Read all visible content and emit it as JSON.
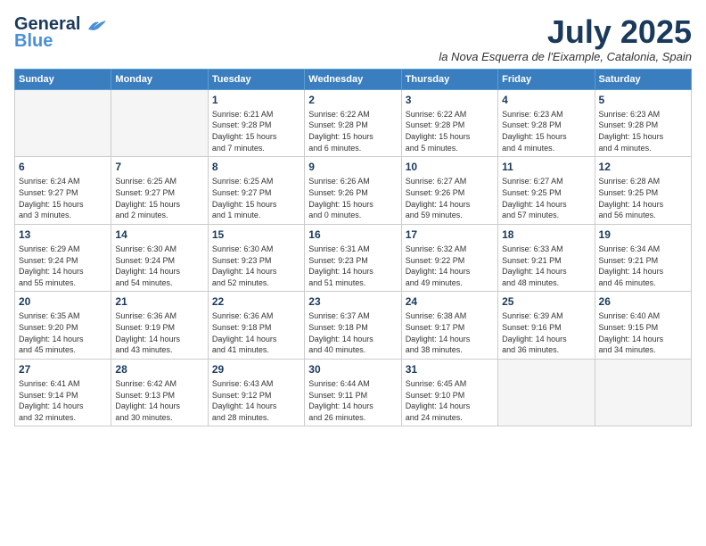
{
  "logo": {
    "line1": "General",
    "line2": "Blue"
  },
  "title": "July 2025",
  "subtitle": "la Nova Esquerra de l'Eixample, Catalonia, Spain",
  "days_header": [
    "Sunday",
    "Monday",
    "Tuesday",
    "Wednesday",
    "Thursday",
    "Friday",
    "Saturday"
  ],
  "weeks": [
    [
      {
        "day": "",
        "info": ""
      },
      {
        "day": "",
        "info": ""
      },
      {
        "day": "1",
        "info": "Sunrise: 6:21 AM\nSunset: 9:28 PM\nDaylight: 15 hours\nand 7 minutes."
      },
      {
        "day": "2",
        "info": "Sunrise: 6:22 AM\nSunset: 9:28 PM\nDaylight: 15 hours\nand 6 minutes."
      },
      {
        "day": "3",
        "info": "Sunrise: 6:22 AM\nSunset: 9:28 PM\nDaylight: 15 hours\nand 5 minutes."
      },
      {
        "day": "4",
        "info": "Sunrise: 6:23 AM\nSunset: 9:28 PM\nDaylight: 15 hours\nand 4 minutes."
      },
      {
        "day": "5",
        "info": "Sunrise: 6:23 AM\nSunset: 9:28 PM\nDaylight: 15 hours\nand 4 minutes."
      }
    ],
    [
      {
        "day": "6",
        "info": "Sunrise: 6:24 AM\nSunset: 9:27 PM\nDaylight: 15 hours\nand 3 minutes."
      },
      {
        "day": "7",
        "info": "Sunrise: 6:25 AM\nSunset: 9:27 PM\nDaylight: 15 hours\nand 2 minutes."
      },
      {
        "day": "8",
        "info": "Sunrise: 6:25 AM\nSunset: 9:27 PM\nDaylight: 15 hours\nand 1 minute."
      },
      {
        "day": "9",
        "info": "Sunrise: 6:26 AM\nSunset: 9:26 PM\nDaylight: 15 hours\nand 0 minutes."
      },
      {
        "day": "10",
        "info": "Sunrise: 6:27 AM\nSunset: 9:26 PM\nDaylight: 14 hours\nand 59 minutes."
      },
      {
        "day": "11",
        "info": "Sunrise: 6:27 AM\nSunset: 9:25 PM\nDaylight: 14 hours\nand 57 minutes."
      },
      {
        "day": "12",
        "info": "Sunrise: 6:28 AM\nSunset: 9:25 PM\nDaylight: 14 hours\nand 56 minutes."
      }
    ],
    [
      {
        "day": "13",
        "info": "Sunrise: 6:29 AM\nSunset: 9:24 PM\nDaylight: 14 hours\nand 55 minutes."
      },
      {
        "day": "14",
        "info": "Sunrise: 6:30 AM\nSunset: 9:24 PM\nDaylight: 14 hours\nand 54 minutes."
      },
      {
        "day": "15",
        "info": "Sunrise: 6:30 AM\nSunset: 9:23 PM\nDaylight: 14 hours\nand 52 minutes."
      },
      {
        "day": "16",
        "info": "Sunrise: 6:31 AM\nSunset: 9:23 PM\nDaylight: 14 hours\nand 51 minutes."
      },
      {
        "day": "17",
        "info": "Sunrise: 6:32 AM\nSunset: 9:22 PM\nDaylight: 14 hours\nand 49 minutes."
      },
      {
        "day": "18",
        "info": "Sunrise: 6:33 AM\nSunset: 9:21 PM\nDaylight: 14 hours\nand 48 minutes."
      },
      {
        "day": "19",
        "info": "Sunrise: 6:34 AM\nSunset: 9:21 PM\nDaylight: 14 hours\nand 46 minutes."
      }
    ],
    [
      {
        "day": "20",
        "info": "Sunrise: 6:35 AM\nSunset: 9:20 PM\nDaylight: 14 hours\nand 45 minutes."
      },
      {
        "day": "21",
        "info": "Sunrise: 6:36 AM\nSunset: 9:19 PM\nDaylight: 14 hours\nand 43 minutes."
      },
      {
        "day": "22",
        "info": "Sunrise: 6:36 AM\nSunset: 9:18 PM\nDaylight: 14 hours\nand 41 minutes."
      },
      {
        "day": "23",
        "info": "Sunrise: 6:37 AM\nSunset: 9:18 PM\nDaylight: 14 hours\nand 40 minutes."
      },
      {
        "day": "24",
        "info": "Sunrise: 6:38 AM\nSunset: 9:17 PM\nDaylight: 14 hours\nand 38 minutes."
      },
      {
        "day": "25",
        "info": "Sunrise: 6:39 AM\nSunset: 9:16 PM\nDaylight: 14 hours\nand 36 minutes."
      },
      {
        "day": "26",
        "info": "Sunrise: 6:40 AM\nSunset: 9:15 PM\nDaylight: 14 hours\nand 34 minutes."
      }
    ],
    [
      {
        "day": "27",
        "info": "Sunrise: 6:41 AM\nSunset: 9:14 PM\nDaylight: 14 hours\nand 32 minutes."
      },
      {
        "day": "28",
        "info": "Sunrise: 6:42 AM\nSunset: 9:13 PM\nDaylight: 14 hours\nand 30 minutes."
      },
      {
        "day": "29",
        "info": "Sunrise: 6:43 AM\nSunset: 9:12 PM\nDaylight: 14 hours\nand 28 minutes."
      },
      {
        "day": "30",
        "info": "Sunrise: 6:44 AM\nSunset: 9:11 PM\nDaylight: 14 hours\nand 26 minutes."
      },
      {
        "day": "31",
        "info": "Sunrise: 6:45 AM\nSunset: 9:10 PM\nDaylight: 14 hours\nand 24 minutes."
      },
      {
        "day": "",
        "info": ""
      },
      {
        "day": "",
        "info": ""
      }
    ]
  ]
}
